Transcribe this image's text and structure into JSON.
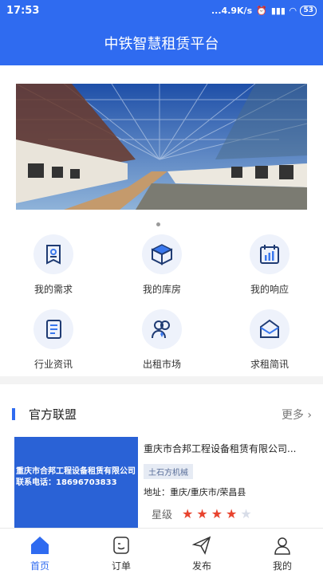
{
  "status": {
    "time": "17:53",
    "speed": "...4.9K/s",
    "battery": "53"
  },
  "header": {
    "title": "中铁智慧租赁平台"
  },
  "grid": [
    {
      "label": "我的需求",
      "icon": "doc-badge-icon"
    },
    {
      "label": "我的库房",
      "icon": "box-icon"
    },
    {
      "label": "我的响应",
      "icon": "calendar-chart-icon"
    },
    {
      "label": "行业资讯",
      "icon": "news-icon"
    },
    {
      "label": "出租市场",
      "icon": "people-icon"
    },
    {
      "label": "求租简讯",
      "icon": "mail-icon"
    }
  ],
  "section": {
    "title": "官方联盟",
    "more": "更多"
  },
  "card": {
    "image_line1": "重庆市合邦工程设备租赁有限公司",
    "image_line2": "联系电话：18696703833",
    "name": "重庆市合邦工程设备租赁有限公司...",
    "tag": "土石方机械",
    "address": "地址：重庆/重庆市/荣昌县",
    "rating_label": "星级",
    "rating": 4,
    "rating_max": 5
  },
  "tabs": [
    {
      "label": "首页",
      "icon": "home-icon"
    },
    {
      "label": "订单",
      "icon": "order-icon"
    },
    {
      "label": "发布",
      "icon": "send-icon"
    },
    {
      "label": "我的",
      "icon": "user-icon"
    }
  ]
}
